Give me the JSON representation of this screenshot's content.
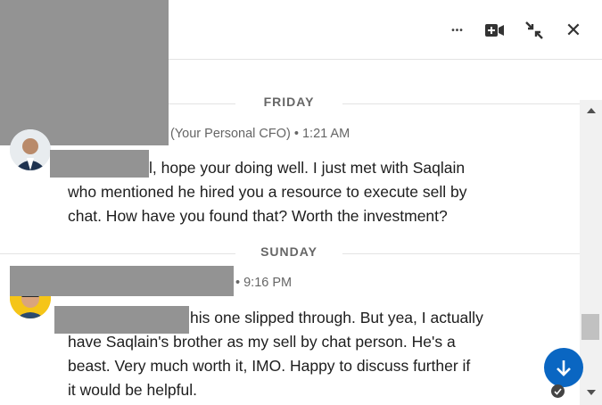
{
  "header": {
    "actions": [
      {
        "name": "more-options",
        "icon": "ellipsis-icon"
      },
      {
        "name": "video-call",
        "icon": "video-plus-icon"
      },
      {
        "name": "minimize",
        "icon": "collapse-arrows-icon"
      },
      {
        "name": "close",
        "icon": "close-icon"
      }
    ],
    "more_glyph": "•••",
    "close_glyph": "✕"
  },
  "conversation": {
    "days": [
      {
        "label": "FRIDAY"
      },
      {
        "label": "SUNDAY"
      }
    ],
    "messages": [
      {
        "sender_suffix": "(Your Personal CFO) • 1:21 AM",
        "lines": [
          "l, hope your doing well. I just met with Saqlain",
          "who mentioned he hired you a resource to execute sell by",
          "chat. How have you found that? Worth the investment?"
        ]
      },
      {
        "sender_suffix": "• 9:16 PM",
        "lines": [
          "his one slipped through. But yea, I actually",
          "have Saqlain's brother as my sell by chat person. He's a",
          "beast. Very much worth it, IMO. Happy to discuss further if",
          "it would be helpful."
        ]
      }
    ]
  },
  "colors": {
    "brand_blue": "#0a66c2",
    "redaction_gray": "#939393",
    "avatar_yellow": "#f5c518"
  }
}
